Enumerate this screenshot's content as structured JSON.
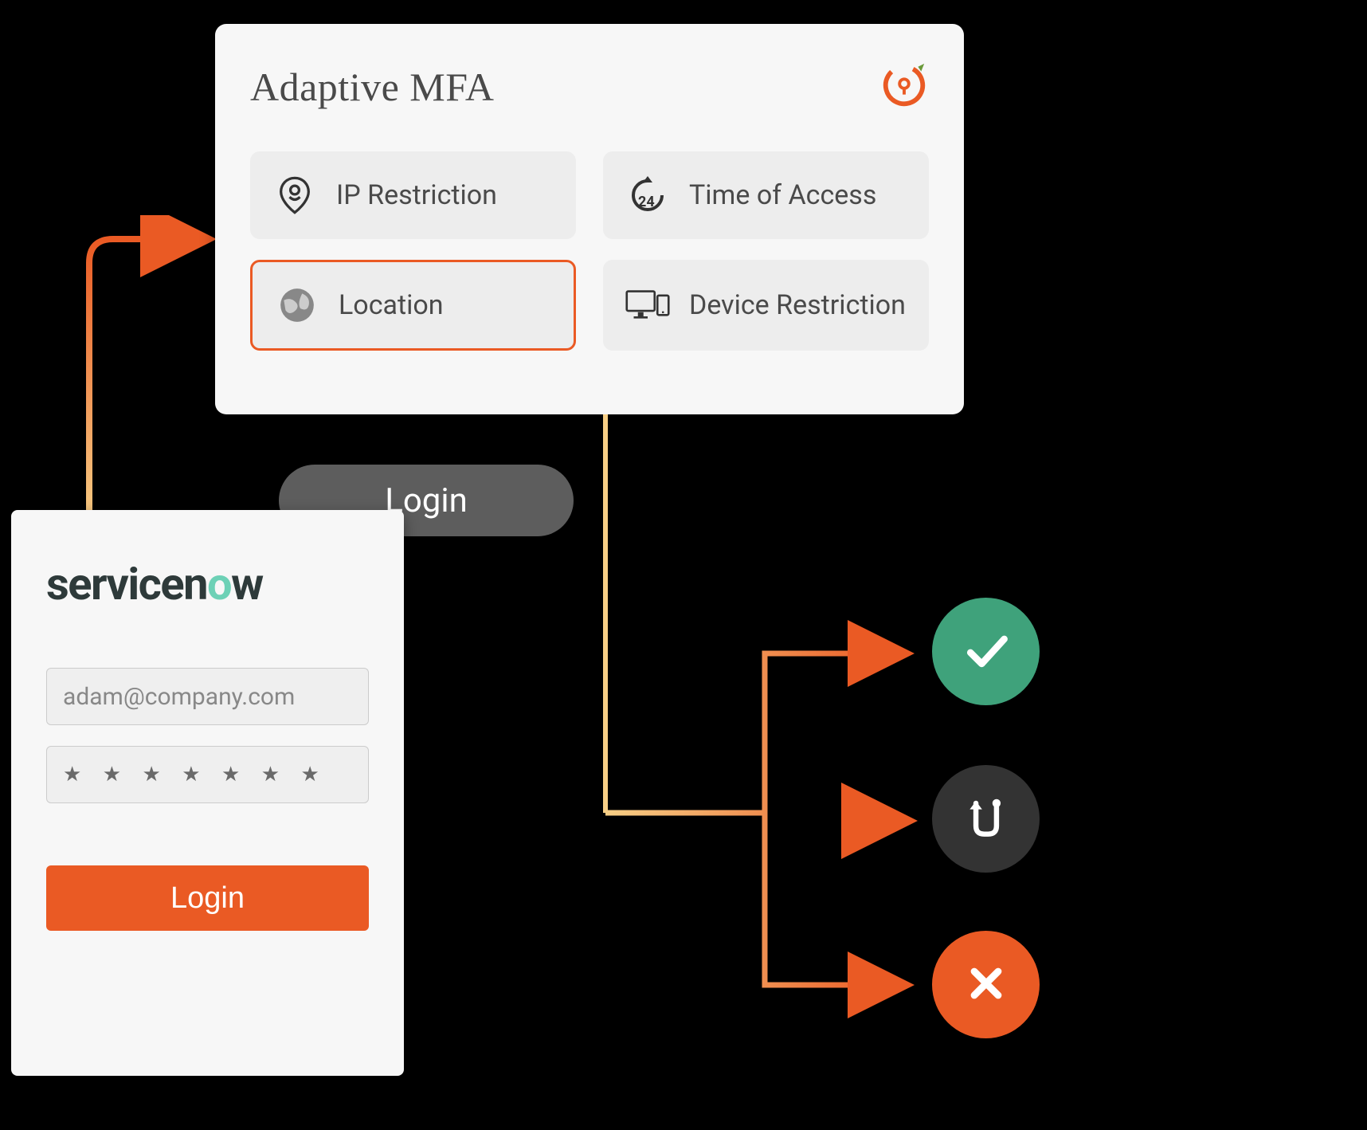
{
  "mfa": {
    "title": "Adaptive MFA",
    "items": {
      "ip": "IP Restriction",
      "time": "Time of Access",
      "location": "Location",
      "device": "Device Restriction"
    }
  },
  "login_bubble": "Login",
  "login_card": {
    "brand_prefix": "servicen",
    "brand_o": "o",
    "brand_suffix": "w",
    "email": "adam@company.com",
    "password_mask": "★ ★ ★ ★ ★ ★ ★",
    "button": "Login"
  },
  "flow_arrow_color_start": "#f7cf86",
  "flow_arrow_color_end": "#ea5a24"
}
